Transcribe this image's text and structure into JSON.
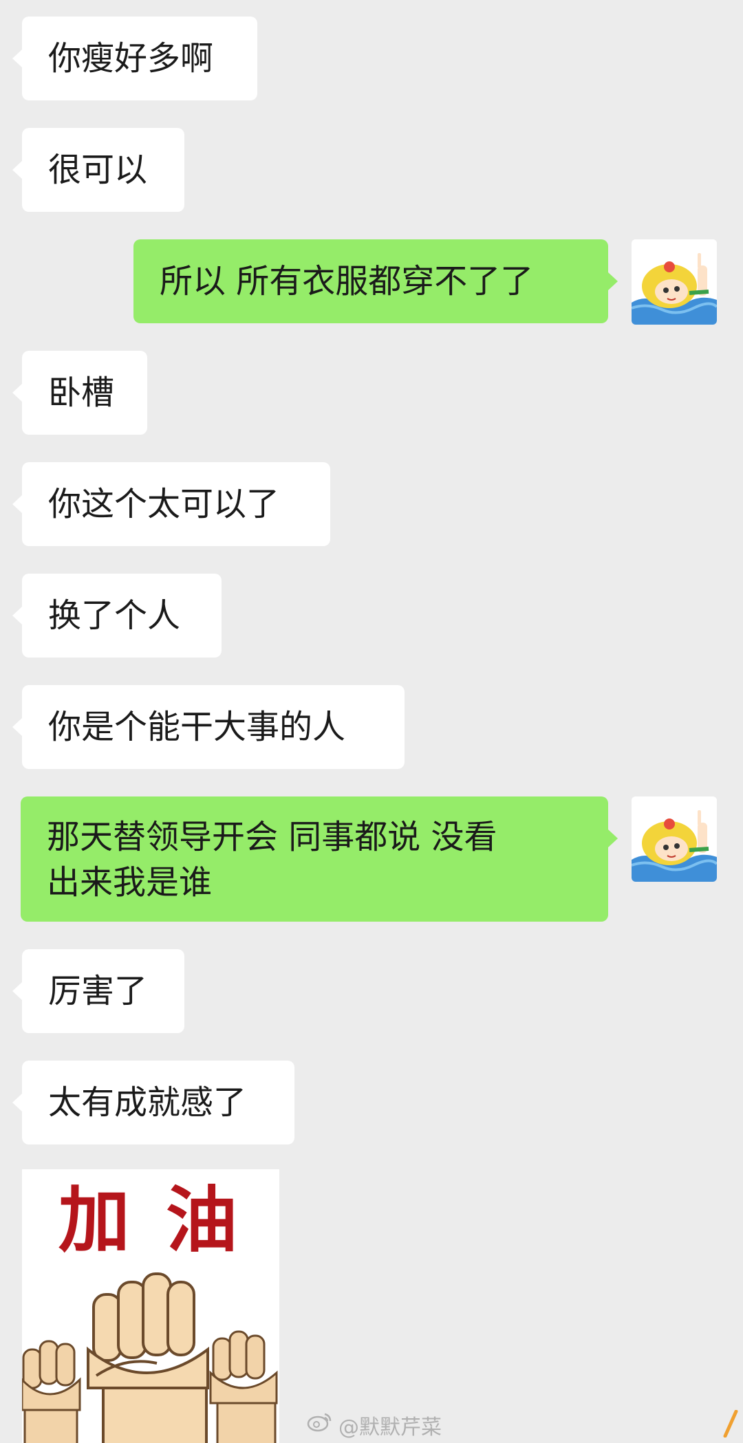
{
  "messages": [
    {
      "side": "left",
      "text": "你瘦好多啊"
    },
    {
      "side": "left",
      "text": "很可以"
    },
    {
      "side": "right",
      "text": "所以  所有衣服都穿不了了"
    },
    {
      "side": "left",
      "text": "卧槽"
    },
    {
      "side": "left",
      "text": "你这个太可以了"
    },
    {
      "side": "left",
      "text": "换了个人"
    },
    {
      "side": "left",
      "text": "你是个能干大事的人"
    },
    {
      "side": "right",
      "text": "那天替领导开会  同事都说   没看",
      "text_line2": "出来我是谁"
    },
    {
      "side": "left",
      "text": "厉害了"
    },
    {
      "side": "left",
      "text": "太有成就感了"
    }
  ],
  "sticker": {
    "text": "加 油",
    "icon": "raised-fists-sticker",
    "text_color": "#b5151b"
  },
  "avatar": {
    "icon": "cartoon-girl-swimming-avatar"
  },
  "watermark": {
    "text": "@默默芹菜",
    "icon": "weibo-icon"
  },
  "colors": {
    "background": "#ececec",
    "incoming_bubble": "#ffffff",
    "outgoing_bubble": "#95ec69",
    "text": "#1a1a1a"
  }
}
